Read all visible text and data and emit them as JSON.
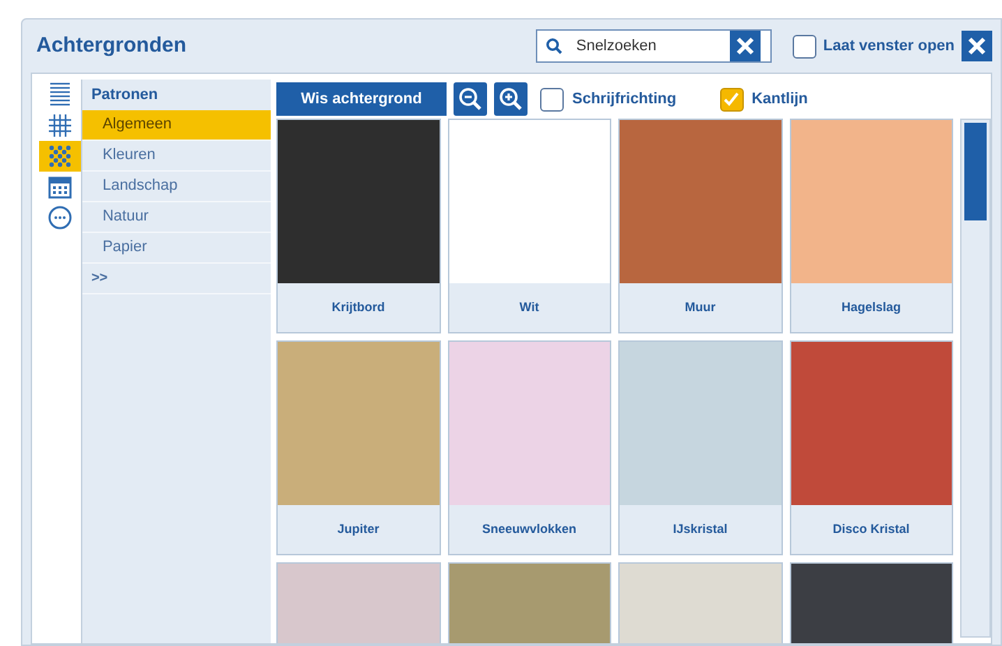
{
  "window": {
    "title": "Achtergronden"
  },
  "search": {
    "placeholder": "Snelzoeken"
  },
  "keep_open": {
    "label": "Laat venster open",
    "checked": false
  },
  "view_tabs": [
    {
      "kind": "lines",
      "selected": false
    },
    {
      "kind": "grid",
      "selected": false
    },
    {
      "kind": "dots",
      "selected": true
    },
    {
      "kind": "calendar",
      "selected": false
    },
    {
      "kind": "more",
      "selected": false
    }
  ],
  "categories": {
    "heading": "Patronen",
    "items": [
      {
        "label": "Algemeen",
        "selected": true
      },
      {
        "label": "Kleuren",
        "selected": false
      },
      {
        "label": "Landschap",
        "selected": false
      },
      {
        "label": "Natuur",
        "selected": false
      },
      {
        "label": "Papier",
        "selected": false
      }
    ],
    "more": ">>"
  },
  "toolbar": {
    "clear_button": "Wis achtergrond",
    "options": [
      {
        "label": "Schrijfrichting",
        "checked": false
      },
      {
        "label": "Kantlijn",
        "checked": true
      }
    ]
  },
  "tiles": [
    {
      "label": "Krijtbord",
      "color": "#2e2e2e"
    },
    {
      "label": "Wit",
      "color": "#ffffff"
    },
    {
      "label": "Muur",
      "color": "#b8663f"
    },
    {
      "label": "Hagelslag",
      "color": "#f2b48a"
    },
    {
      "label": "Jupiter",
      "color": "#c9ae7a"
    },
    {
      "label": "Sneeuwvlokken",
      "color": "#ecd3e6"
    },
    {
      "label": "IJskristal",
      "color": "#c6d6df"
    },
    {
      "label": "Disco Kristal",
      "color": "#c04a3a"
    },
    {
      "color": "#d8c7cc"
    },
    {
      "color": "#a79a6f"
    },
    {
      "color": "#dedbd2"
    },
    {
      "color": "#3c3e44"
    }
  ]
}
